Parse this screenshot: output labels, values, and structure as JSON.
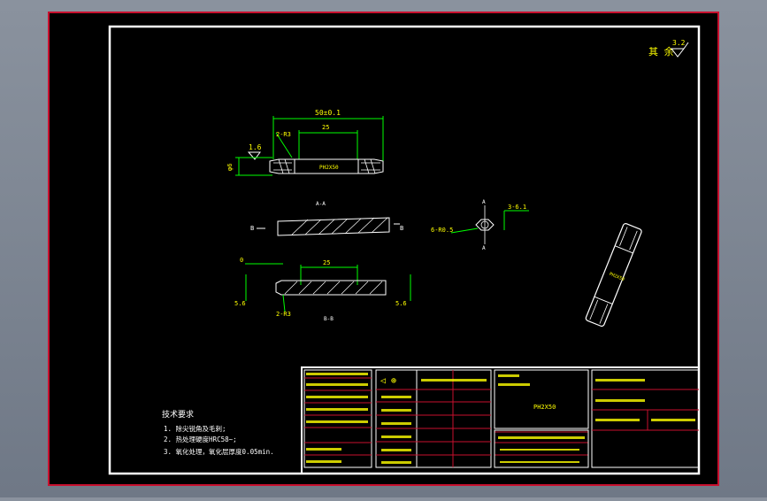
{
  "drawing": {
    "roughness_rest": "其 余",
    "roughness_rest_value": "3.2",
    "dim_overall": "50±0.1",
    "dim_chamfer_left": "2-R3",
    "dim_section_len_top": "25",
    "dim_section_len_mid": "25",
    "dim_diameter": "φ6",
    "roughness_local": "1.6",
    "part_label": "PH2X50",
    "section_aa_label": "A-A",
    "section_bb_label": "B-B",
    "marker_b": "B",
    "marker_a": "A",
    "dim_hex_width": "6-R0.5",
    "dim_hex_small": "3-6.1",
    "dim_offset_zero": "0",
    "dim_left_depth": "5.6",
    "dim_right_depth": "5.6",
    "dim_chamfer_bottom": "2-R3"
  },
  "tech_requirements": {
    "title": "技术要求",
    "items": [
      "1. 除尖锐角及毛刺;",
      "2. 热处理硬度HRC58~;",
      "3. 氧化处理，氧化层厚度0.05min."
    ]
  },
  "title_block": {
    "part_name": "PH2X50",
    "symbols": "◁ ⊕"
  }
}
